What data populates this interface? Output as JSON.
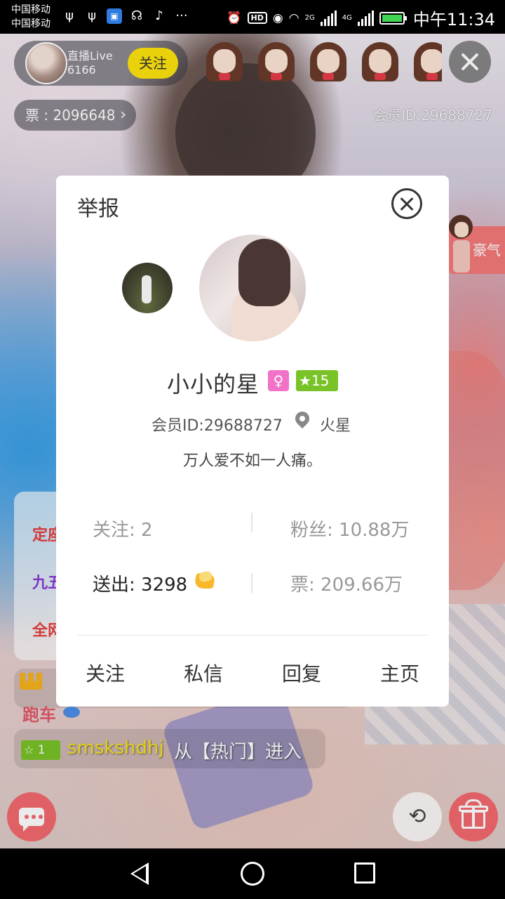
{
  "status_bar": {
    "carrier_1": "中国移动",
    "carrier_2": "中国移动",
    "network_1": "2G",
    "network_2": "4G",
    "hd": "HD",
    "time": "中午11:34"
  },
  "live": {
    "anchor_name": "直播Live",
    "anchor_id": "6166",
    "follow_label": "关注",
    "ticket_label": "票 : 2096648",
    "member_watermark": "会员ID:29688727",
    "rich_tag": "豪气"
  },
  "chat": {
    "line_1": "定座",
    "line_2": "九五",
    "line_3": "全网",
    "msg_1": "跑车",
    "entry_level": "1",
    "entry_user": "smskshdhj",
    "entry_text": "从【热门】进入"
  },
  "profile_card": {
    "report_label": "举报",
    "nickname": "小小的星",
    "gender_icon": "female-icon",
    "level": "15",
    "member_id": "会员ID:29688727",
    "location": "火星",
    "signature": "万人爱不如一人痛。",
    "stats": {
      "following": "关注: 2",
      "fans": "粉丝: 10.88万",
      "sent": "送出: 3298",
      "tickets": "票: 209.66万"
    },
    "actions": {
      "follow": "关注",
      "message": "私信",
      "reply": "回复",
      "homepage": "主页"
    }
  },
  "colors": {
    "follow_yellow": "#fde30e",
    "accent_red": "#f46a6e",
    "level_green": "#79c228",
    "gender_pink": "#f272c7"
  }
}
